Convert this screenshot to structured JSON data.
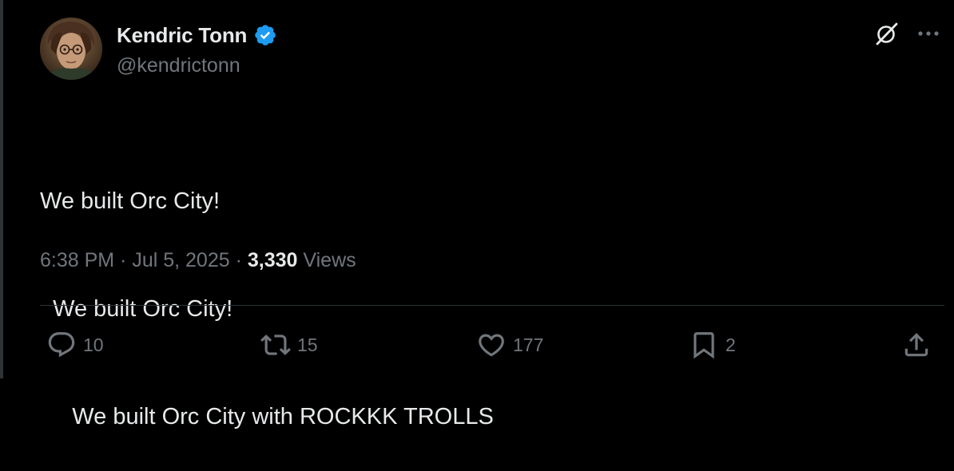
{
  "author": {
    "display_name": "Kendric Tonn",
    "handle": "@kendrictonn",
    "verified": true
  },
  "tweet": {
    "lines": [
      "We built Orc City!",
      "  We built Orc City!",
      "     We built Orc City with ROCKKK TROLLS"
    ]
  },
  "meta": {
    "time": "6:38 PM",
    "sep1": " · ",
    "date": "Jul 5, 2025",
    "sep2": " · ",
    "views_count": "3,330",
    "views_label": " Views"
  },
  "actions": {
    "reply_count": "10",
    "repost_count": "15",
    "like_count": "177",
    "bookmark_count": "2"
  },
  "icons": {
    "verified": "verified-badge-icon",
    "grok": "grok-icon",
    "more": "more-icon",
    "reply": "reply-icon",
    "repost": "repost-icon",
    "like": "heart-icon",
    "bookmark": "bookmark-icon",
    "share": "share-icon"
  },
  "colors": {
    "background": "#000000",
    "primary_text": "#e7e9ea",
    "secondary_text": "#71767b",
    "verified_blue": "#1d9bf0",
    "divider": "#2f3336"
  }
}
